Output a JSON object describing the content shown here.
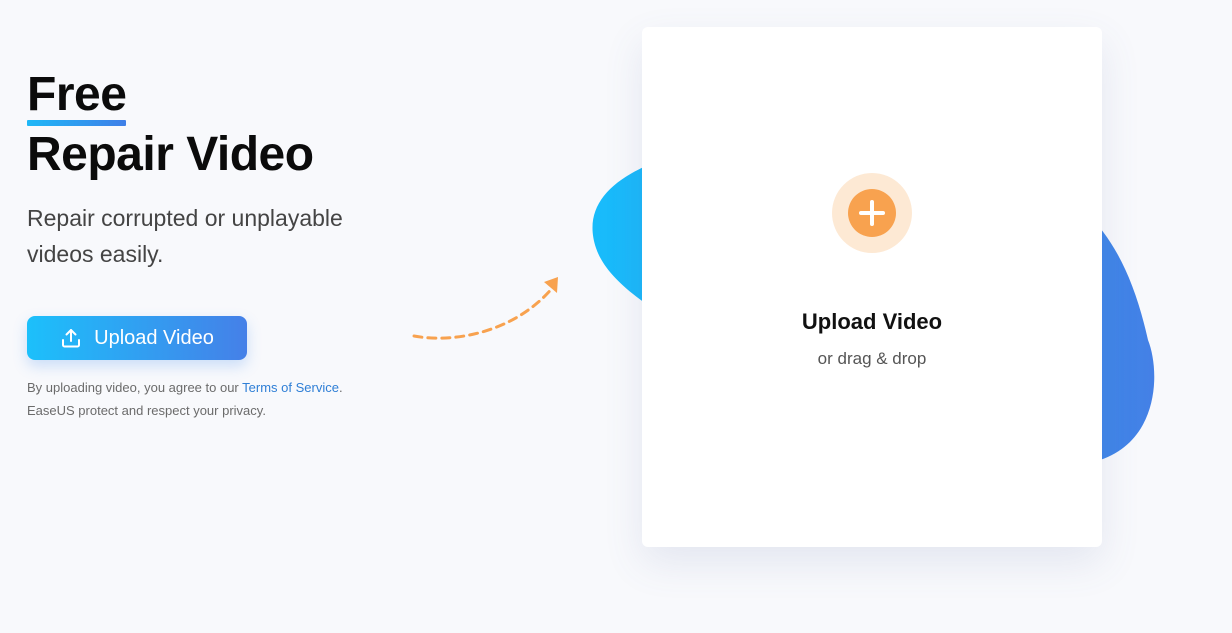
{
  "hero": {
    "title_line1": "Free",
    "title_line2": "Repair Video",
    "subtitle": "Repair corrupted or unplayable videos easily.",
    "upload_button_label": "Upload Video",
    "notice_prefix": "By uploading video, you agree to our",
    "terms_link": "Terms of Service",
    "notice_suffix": ".",
    "notice_line2": "EaseUS protect and respect your privacy."
  },
  "dropzone": {
    "title": "Upload Video",
    "subtitle": "or drag & drop",
    "icon": "plus-icon"
  },
  "colors": {
    "accent_blue_start": "#1cc0fb",
    "accent_blue_end": "#4580e8",
    "accent_orange": "#f8a24f",
    "link": "#2f7fd6"
  }
}
